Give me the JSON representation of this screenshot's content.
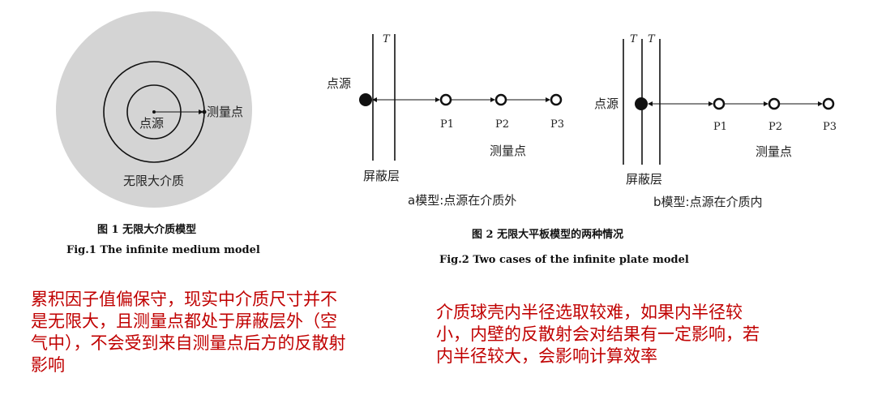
{
  "fig1": {
    "source_label": "点源",
    "measure_label": "测量点",
    "medium_label": "无限大介质",
    "caption_cn": "图 1   无限大介质模型",
    "caption_en": "Fig.1   The infinite medium model"
  },
  "fig2": {
    "a": {
      "thickness_label": "T",
      "source_label": "点源",
      "points": [
        "P1",
        "P2",
        "P3"
      ],
      "measure_label": "测量点",
      "shield_label": "屏蔽层",
      "caption": "a模型:点源在介质外"
    },
    "b": {
      "thickness_labels": [
        "T",
        "T"
      ],
      "source_label": "点源",
      "points": [
        "P1",
        "P2",
        "P3"
      ],
      "measure_label": "测量点",
      "shield_label": "屏蔽层",
      "caption": "b模型:点源在介质内"
    },
    "caption_cn": "图 2   无限大平板模型的两种情况",
    "caption_en": "Fig.2   Two cases of the infinite plate model"
  },
  "notes": {
    "left": "累积因子值偏保守，现实中介质尺寸并不是无限大，且测量点都处于屏蔽层外（空气中），不会受到来自测量点后方的反散射影响",
    "right": "介质球壳内半径选取较难，如果内半径较小，内壁的反散射会对结果有一定影响，若内半径较大，会影响计算效率"
  },
  "colors": {
    "note": "#c00000",
    "medium": "#d4d4d4"
  }
}
